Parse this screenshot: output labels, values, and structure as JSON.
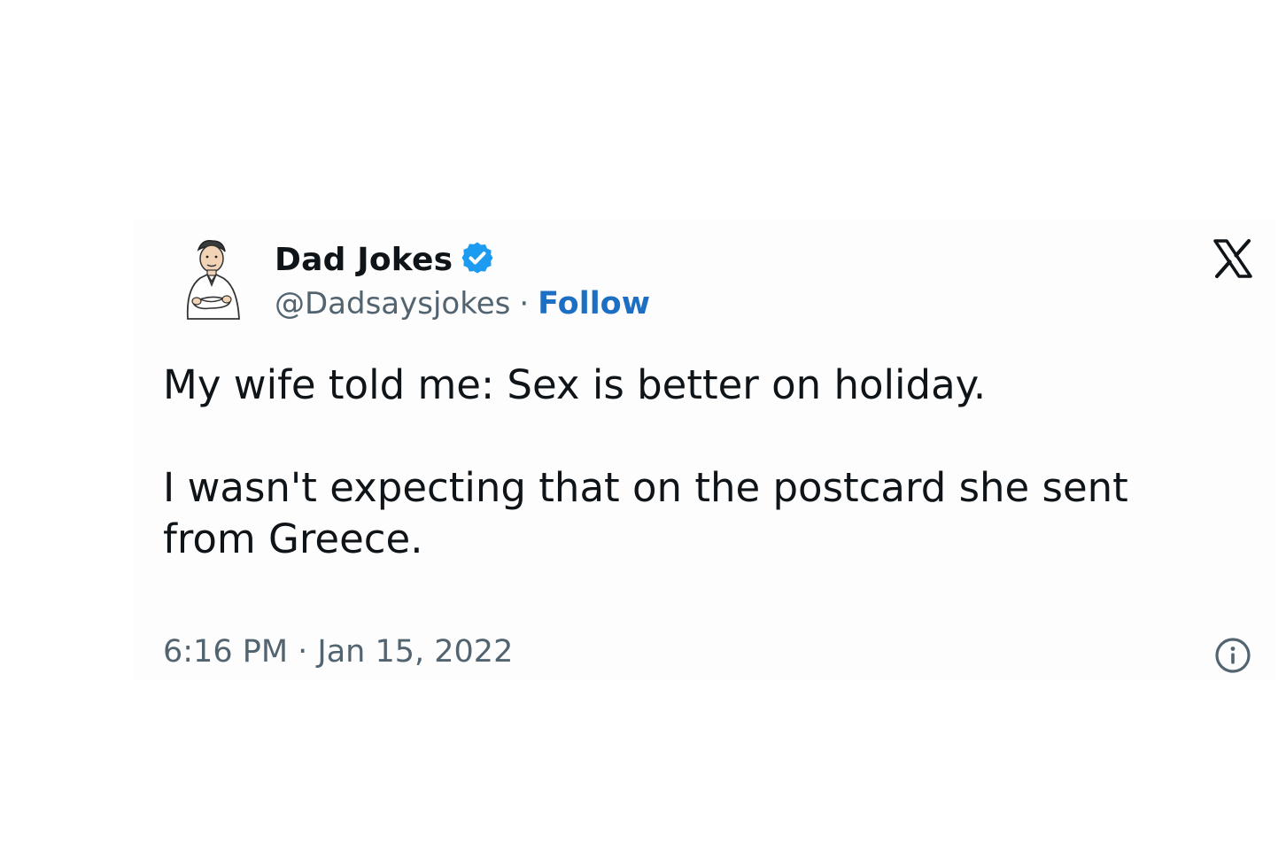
{
  "author": {
    "name": "Dad Jokes",
    "handle": "@Dadsaysjokes",
    "separator": "·",
    "follow_label": "Follow"
  },
  "tweet": {
    "paragraphs": [
      "My wife told me: Sex is better on holiday.",
      "I wasn't expecting that on the postcard she sent from Greece."
    ],
    "timestamp": "6:16 PM · Jan 15, 2022"
  },
  "icons": {
    "avatar": "dad-cartoon-avatar",
    "verified": "verified-badge-icon",
    "platform": "x-logo-icon",
    "info": "info-icon"
  },
  "colors": {
    "text": "#0f1419",
    "secondary_text": "#536471",
    "link": "#1d6fc4",
    "verified": "#1d9bf0"
  }
}
